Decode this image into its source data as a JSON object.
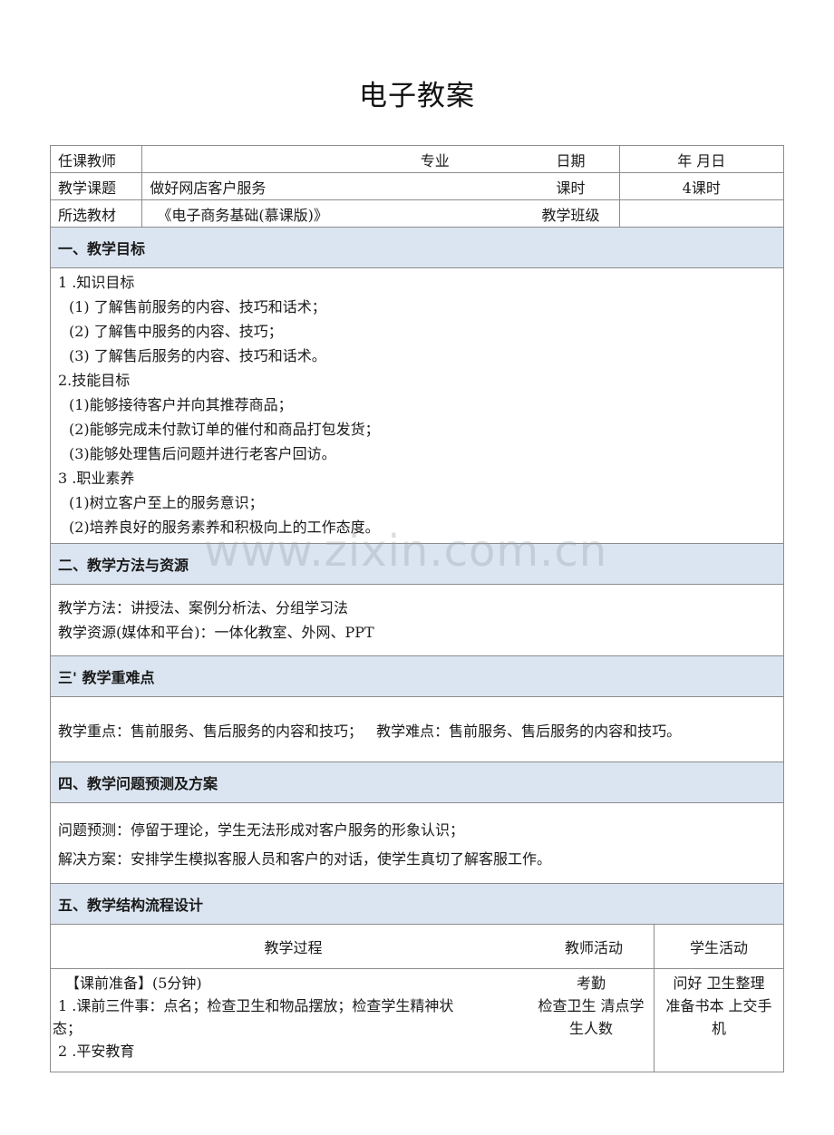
{
  "title": "电子教案",
  "header_table": {
    "rows": [
      {
        "label": "任课教师",
        "value": "",
        "mid_label": "专业",
        "right_label": "日期",
        "right_value": "年  月日"
      },
      {
        "label": "教学课题",
        "value": "做好网店客户服务",
        "mid_label": "",
        "right_label": "课时",
        "right_value": "4课时"
      },
      {
        "label": "所选教材",
        "value": "《电子商务基础(慕课版)》",
        "mid_label": "",
        "right_label": "教学班级",
        "right_value": ""
      }
    ]
  },
  "sections": {
    "objectives": {
      "heading": "一、教学目标",
      "groups": [
        {
          "title": "1 .知识目标",
          "items": [
            "(1)  了解售前服务的内容、技巧和话术；",
            "(2)  了解售中服务的内容、技巧；",
            "(3)  了解售后服务的内容、技巧和话术。"
          ]
        },
        {
          "title": "2.技能目标",
          "items": [
            "(1)能够接待客户并向其推荐商品；",
            "(2)能够完成未付款订单的催付和商品打包发货；",
            "(3)能够处理售后问题并进行老客户回访。"
          ]
        },
        {
          "title": "3 .职业素养",
          "items": [
            "(1)树立客户至上的服务意识；",
            "(2)培养良好的服务素养和积极向上的工作态度。"
          ]
        }
      ]
    },
    "methods": {
      "heading": "二、教学方法与资源",
      "lines": [
        "教学方法：讲授法、案例分析法、分组学习法",
        "教学资源(媒体和平台)：一体化教室、外网、PPT"
      ]
    },
    "key_points": {
      "heading": "三' 教学重难点",
      "focus": "教学重点：售前服务、售后服务的内容和技巧；",
      "difficulty": "教学难点：售前服务、售后服务的内容和技巧。"
    },
    "problems": {
      "heading": "四、教学问题预测及方案",
      "lines": [
        "问题预测：停留于理论，学生无法形成对客户服务的形象认识；",
        "解决方案：安排学生模拟客服人员和客户的对话，使学生真切了解客服工作。"
      ]
    },
    "flow": {
      "heading": "五、教学结构流程设计",
      "columns": {
        "process": "教学过程",
        "teacher": "教师活动",
        "student": "学生活动"
      },
      "rows": [
        {
          "process": [
            "【课前准备】(5分钟)",
            "1 .课前三件事：点名；检查卫生和物品摆放；检查学生精神状",
            "态；",
            "2 .平安教育"
          ],
          "teacher": [
            "考勤",
            "检查卫生 清点学",
            "生人数"
          ],
          "student": [
            "问好  卫生整理",
            "准备书本  上交手",
            "机"
          ]
        }
      ]
    }
  },
  "watermark": "www.zixin.com.cn"
}
